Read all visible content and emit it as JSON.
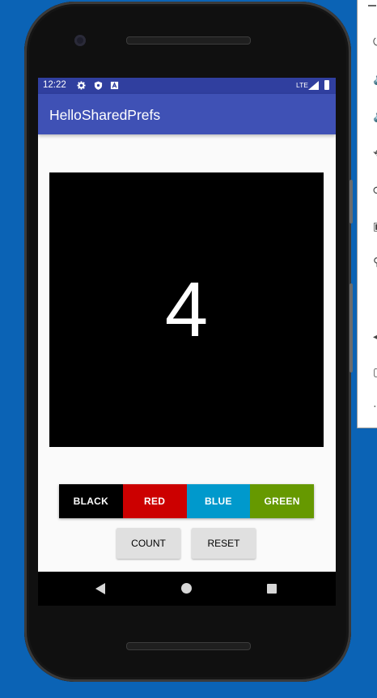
{
  "status_bar": {
    "time": "12:22",
    "network": "LTE",
    "icons": [
      "settings-gear-icon",
      "shield-icon",
      "a-box-icon",
      "signal-icon",
      "battery-icon"
    ]
  },
  "app_bar": {
    "title": "HelloSharedPrefs"
  },
  "main": {
    "count": "4",
    "count_background": "#000000",
    "color_buttons": [
      {
        "label": "BLACK",
        "color": "#000000"
      },
      {
        "label": "RED",
        "color": "#cc0000"
      },
      {
        "label": "BLUE",
        "color": "#0099cc"
      },
      {
        "label": "GREEN",
        "color": "#669900"
      }
    ],
    "count_button": "COUNT",
    "reset_button": "RESET"
  },
  "nav_bar": {
    "icons": [
      "back-icon",
      "home-icon",
      "recents-icon"
    ]
  },
  "colors": {
    "primary": "#3f51b5",
    "primary_dark": "#303f9f",
    "desktop": "#0b63b5"
  }
}
